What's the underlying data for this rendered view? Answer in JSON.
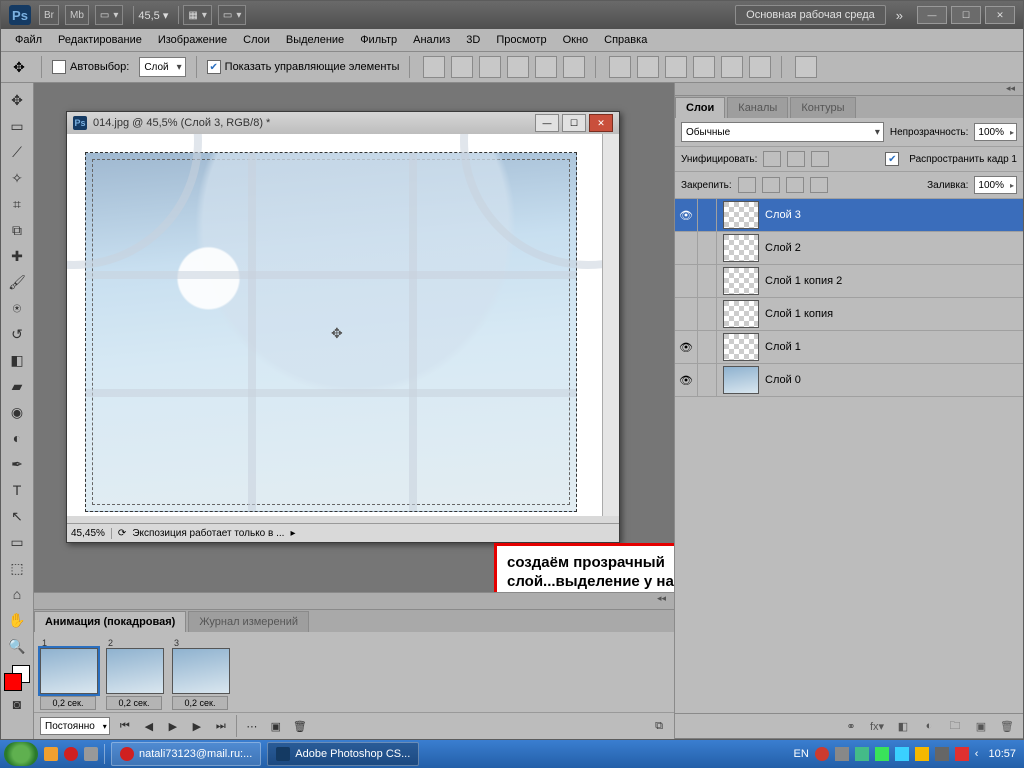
{
  "title": {
    "zoom_top": "45,5",
    "workspace": "Основная рабочая среда"
  },
  "menu": [
    "Файл",
    "Редактирование",
    "Изображение",
    "Слои",
    "Выделение",
    "Фильтр",
    "Анализ",
    "3D",
    "Просмотр",
    "Окно",
    "Справка"
  ],
  "options": {
    "autoselect": "Автовыбор:",
    "autoselect_target": "Слой",
    "show_transform": "Показать управляющие элементы"
  },
  "document": {
    "title": "014.jpg @ 45,5% (Слой 3, RGB/8) *",
    "status_zoom": "45,45%",
    "status_info": "Экспозиция работает только в ..."
  },
  "layers_panel": {
    "tabs": [
      "Слои",
      "Каналы",
      "Контуры"
    ],
    "mode": "Обычные",
    "opacity_label": "Непрозрачность:",
    "opacity": "100%",
    "unify_label": "Унифицировать:",
    "propagate": "Распространить кадр 1",
    "lock_label": "Закрепить:",
    "fill_label": "Заливка:",
    "fill": "100%",
    "layers": [
      {
        "name": "Слой 3",
        "selected": true,
        "transparent": true,
        "visible": true
      },
      {
        "name": "Слой 2",
        "selected": false,
        "transparent": true,
        "visible": false
      },
      {
        "name": "Слой 1 копия 2",
        "selected": false,
        "transparent": true,
        "visible": false
      },
      {
        "name": "Слой 1 копия",
        "selected": false,
        "transparent": true,
        "visible": false
      },
      {
        "name": "Слой 1",
        "selected": false,
        "transparent": true,
        "visible": true
      },
      {
        "name": "Слой 0",
        "selected": false,
        "transparent": false,
        "visible": true
      }
    ]
  },
  "animation": {
    "tabs": [
      "Анимация (покадровая)",
      "Журнал измерений"
    ],
    "frames": [
      {
        "n": "1",
        "dur": "0,2 сек."
      },
      {
        "n": "2",
        "dur": "0,2 сек."
      },
      {
        "n": "3",
        "dur": "0,2 сек."
      }
    ],
    "loop": "Постоянно"
  },
  "callout": "создаём прозрачный слой...выделение у нас остаётся..мы его не убираем",
  "taskbar": {
    "task_mail": "natali73123@mail.ru:...",
    "task_ps": "Adobe Photoshop CS...",
    "lang": "EN",
    "clock": "10:57"
  }
}
